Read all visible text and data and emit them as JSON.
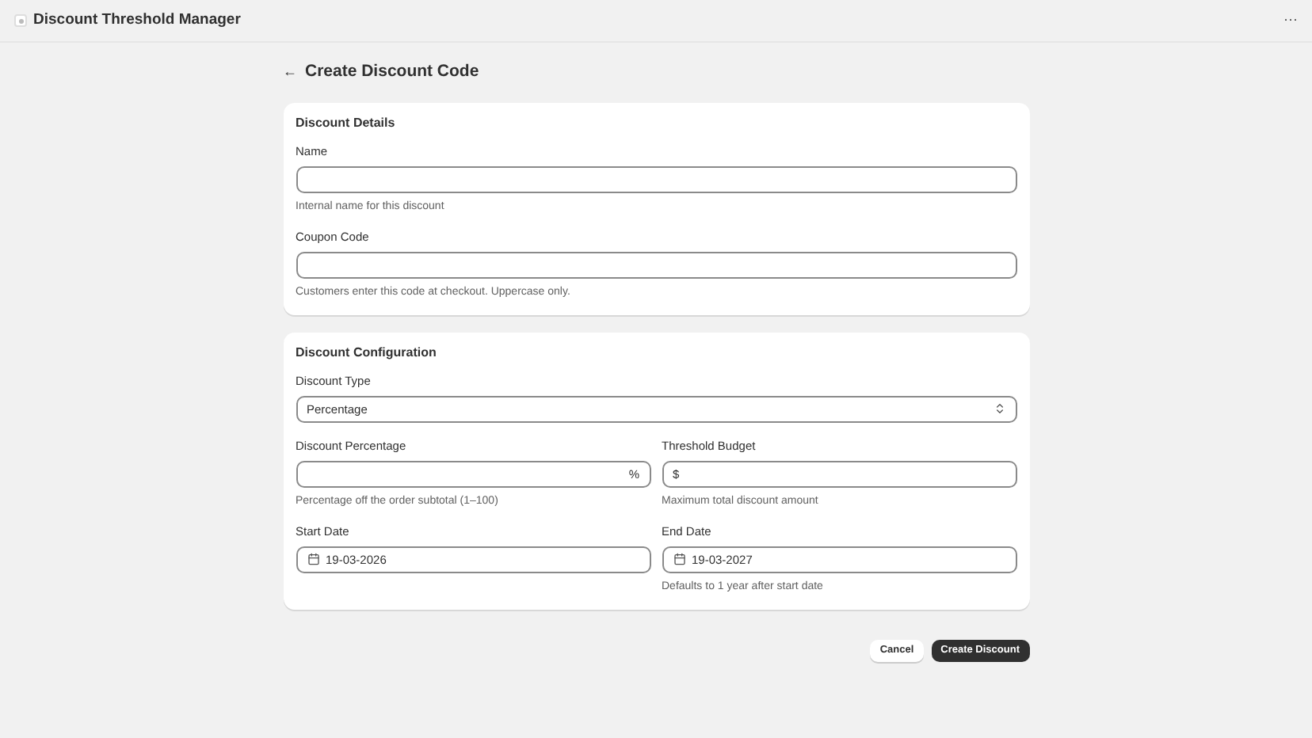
{
  "app": {
    "title": "Discount Threshold Manager",
    "menu": "···"
  },
  "page": {
    "back": "←",
    "title": "Create Discount Code"
  },
  "sections": [
    {
      "title": "Discount Details",
      "rows": [
        [
          {
            "kind": "text",
            "label": "Name",
            "help": "Internal name for this discount"
          }
        ],
        [
          {
            "kind": "text",
            "label": "Coupon Code",
            "help": "Customers enter this code at checkout. Uppercase only."
          }
        ]
      ]
    },
    {
      "title": "Discount Configuration",
      "rows": [
        [
          {
            "kind": "select",
            "label": "Discount Type",
            "value": "Percentage"
          }
        ],
        [
          {
            "kind": "suffix",
            "label": "Discount Percentage",
            "suffix": "%",
            "help": "Percentage off the order subtotal (1–100)"
          },
          {
            "kind": "prefix",
            "label": "Threshold Budget",
            "prefix": "$",
            "help": "Maximum total discount amount"
          }
        ],
        [
          {
            "kind": "date",
            "label": "Start Date",
            "value": "19-03-2026"
          },
          {
            "kind": "date",
            "label": "End Date",
            "value": "19-03-2027",
            "help": "Defaults to 1 year after start date"
          }
        ]
      ]
    }
  ],
  "actions": [
    {
      "label": "Cancel",
      "kind": "secondary"
    },
    {
      "label": "Create Discount",
      "kind": "primary"
    }
  ]
}
